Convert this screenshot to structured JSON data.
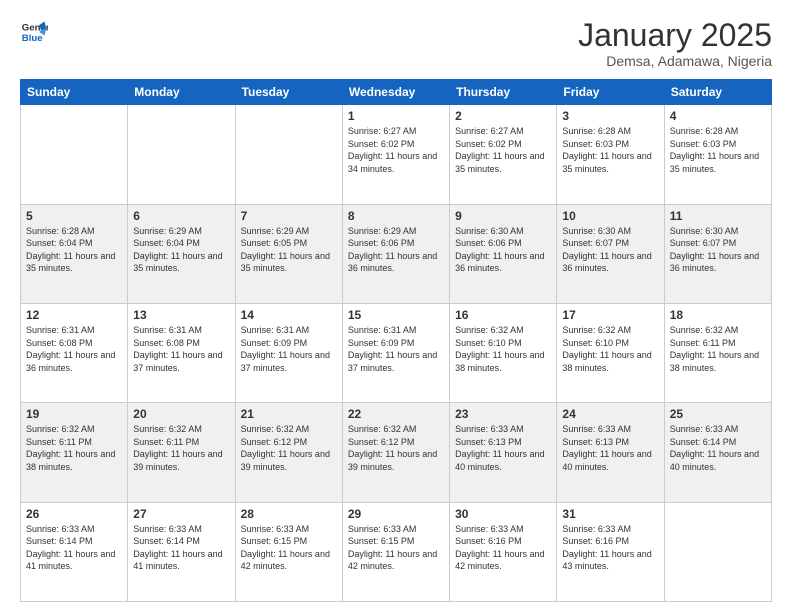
{
  "header": {
    "logo_line1": "General",
    "logo_line2": "Blue",
    "month_title": "January 2025",
    "location": "Demsa, Adamawa, Nigeria"
  },
  "weekdays": [
    "Sunday",
    "Monday",
    "Tuesday",
    "Wednesday",
    "Thursday",
    "Friday",
    "Saturday"
  ],
  "weeks": [
    [
      {
        "day": "",
        "sunrise": "",
        "sunset": "",
        "daylight": ""
      },
      {
        "day": "",
        "sunrise": "",
        "sunset": "",
        "daylight": ""
      },
      {
        "day": "",
        "sunrise": "",
        "sunset": "",
        "daylight": ""
      },
      {
        "day": "1",
        "sunrise": "Sunrise: 6:27 AM",
        "sunset": "Sunset: 6:02 PM",
        "daylight": "Daylight: 11 hours and 34 minutes."
      },
      {
        "day": "2",
        "sunrise": "Sunrise: 6:27 AM",
        "sunset": "Sunset: 6:02 PM",
        "daylight": "Daylight: 11 hours and 35 minutes."
      },
      {
        "day": "3",
        "sunrise": "Sunrise: 6:28 AM",
        "sunset": "Sunset: 6:03 PM",
        "daylight": "Daylight: 11 hours and 35 minutes."
      },
      {
        "day": "4",
        "sunrise": "Sunrise: 6:28 AM",
        "sunset": "Sunset: 6:03 PM",
        "daylight": "Daylight: 11 hours and 35 minutes."
      }
    ],
    [
      {
        "day": "5",
        "sunrise": "Sunrise: 6:28 AM",
        "sunset": "Sunset: 6:04 PM",
        "daylight": "Daylight: 11 hours and 35 minutes."
      },
      {
        "day": "6",
        "sunrise": "Sunrise: 6:29 AM",
        "sunset": "Sunset: 6:04 PM",
        "daylight": "Daylight: 11 hours and 35 minutes."
      },
      {
        "day": "7",
        "sunrise": "Sunrise: 6:29 AM",
        "sunset": "Sunset: 6:05 PM",
        "daylight": "Daylight: 11 hours and 35 minutes."
      },
      {
        "day": "8",
        "sunrise": "Sunrise: 6:29 AM",
        "sunset": "Sunset: 6:06 PM",
        "daylight": "Daylight: 11 hours and 36 minutes."
      },
      {
        "day": "9",
        "sunrise": "Sunrise: 6:30 AM",
        "sunset": "Sunset: 6:06 PM",
        "daylight": "Daylight: 11 hours and 36 minutes."
      },
      {
        "day": "10",
        "sunrise": "Sunrise: 6:30 AM",
        "sunset": "Sunset: 6:07 PM",
        "daylight": "Daylight: 11 hours and 36 minutes."
      },
      {
        "day": "11",
        "sunrise": "Sunrise: 6:30 AM",
        "sunset": "Sunset: 6:07 PM",
        "daylight": "Daylight: 11 hours and 36 minutes."
      }
    ],
    [
      {
        "day": "12",
        "sunrise": "Sunrise: 6:31 AM",
        "sunset": "Sunset: 6:08 PM",
        "daylight": "Daylight: 11 hours and 36 minutes."
      },
      {
        "day": "13",
        "sunrise": "Sunrise: 6:31 AM",
        "sunset": "Sunset: 6:08 PM",
        "daylight": "Daylight: 11 hours and 37 minutes."
      },
      {
        "day": "14",
        "sunrise": "Sunrise: 6:31 AM",
        "sunset": "Sunset: 6:09 PM",
        "daylight": "Daylight: 11 hours and 37 minutes."
      },
      {
        "day": "15",
        "sunrise": "Sunrise: 6:31 AM",
        "sunset": "Sunset: 6:09 PM",
        "daylight": "Daylight: 11 hours and 37 minutes."
      },
      {
        "day": "16",
        "sunrise": "Sunrise: 6:32 AM",
        "sunset": "Sunset: 6:10 PM",
        "daylight": "Daylight: 11 hours and 38 minutes."
      },
      {
        "day": "17",
        "sunrise": "Sunrise: 6:32 AM",
        "sunset": "Sunset: 6:10 PM",
        "daylight": "Daylight: 11 hours and 38 minutes."
      },
      {
        "day": "18",
        "sunrise": "Sunrise: 6:32 AM",
        "sunset": "Sunset: 6:11 PM",
        "daylight": "Daylight: 11 hours and 38 minutes."
      }
    ],
    [
      {
        "day": "19",
        "sunrise": "Sunrise: 6:32 AM",
        "sunset": "Sunset: 6:11 PM",
        "daylight": "Daylight: 11 hours and 38 minutes."
      },
      {
        "day": "20",
        "sunrise": "Sunrise: 6:32 AM",
        "sunset": "Sunset: 6:11 PM",
        "daylight": "Daylight: 11 hours and 39 minutes."
      },
      {
        "day": "21",
        "sunrise": "Sunrise: 6:32 AM",
        "sunset": "Sunset: 6:12 PM",
        "daylight": "Daylight: 11 hours and 39 minutes."
      },
      {
        "day": "22",
        "sunrise": "Sunrise: 6:32 AM",
        "sunset": "Sunset: 6:12 PM",
        "daylight": "Daylight: 11 hours and 39 minutes."
      },
      {
        "day": "23",
        "sunrise": "Sunrise: 6:33 AM",
        "sunset": "Sunset: 6:13 PM",
        "daylight": "Daylight: 11 hours and 40 minutes."
      },
      {
        "day": "24",
        "sunrise": "Sunrise: 6:33 AM",
        "sunset": "Sunset: 6:13 PM",
        "daylight": "Daylight: 11 hours and 40 minutes."
      },
      {
        "day": "25",
        "sunrise": "Sunrise: 6:33 AM",
        "sunset": "Sunset: 6:14 PM",
        "daylight": "Daylight: 11 hours and 40 minutes."
      }
    ],
    [
      {
        "day": "26",
        "sunrise": "Sunrise: 6:33 AM",
        "sunset": "Sunset: 6:14 PM",
        "daylight": "Daylight: 11 hours and 41 minutes."
      },
      {
        "day": "27",
        "sunrise": "Sunrise: 6:33 AM",
        "sunset": "Sunset: 6:14 PM",
        "daylight": "Daylight: 11 hours and 41 minutes."
      },
      {
        "day": "28",
        "sunrise": "Sunrise: 6:33 AM",
        "sunset": "Sunset: 6:15 PM",
        "daylight": "Daylight: 11 hours and 42 minutes."
      },
      {
        "day": "29",
        "sunrise": "Sunrise: 6:33 AM",
        "sunset": "Sunset: 6:15 PM",
        "daylight": "Daylight: 11 hours and 42 minutes."
      },
      {
        "day": "30",
        "sunrise": "Sunrise: 6:33 AM",
        "sunset": "Sunset: 6:16 PM",
        "daylight": "Daylight: 11 hours and 42 minutes."
      },
      {
        "day": "31",
        "sunrise": "Sunrise: 6:33 AM",
        "sunset": "Sunset: 6:16 PM",
        "daylight": "Daylight: 11 hours and 43 minutes."
      },
      {
        "day": "",
        "sunrise": "",
        "sunset": "",
        "daylight": ""
      }
    ]
  ]
}
